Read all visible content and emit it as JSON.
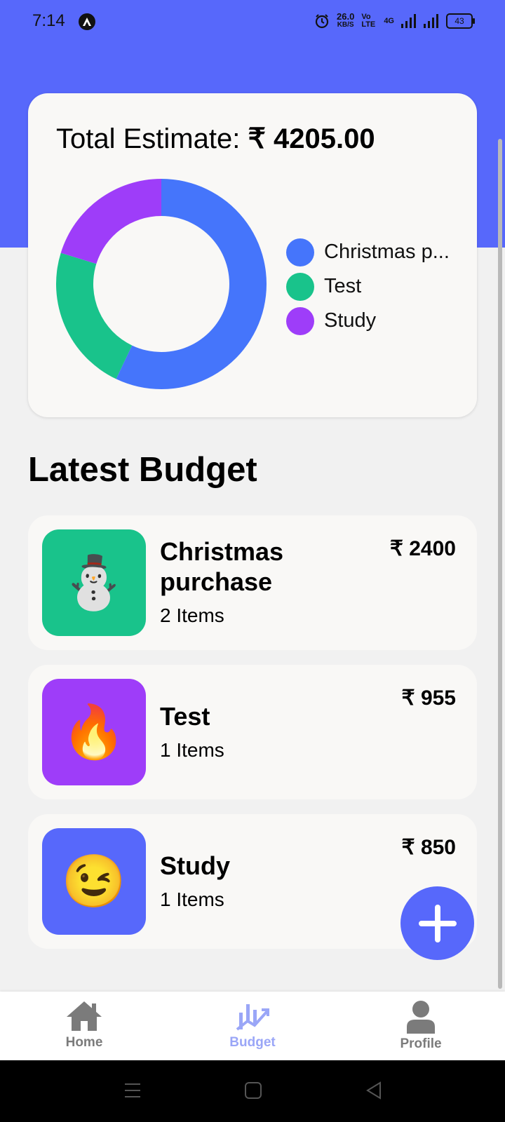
{
  "status_bar": {
    "time": "7:14",
    "net_speed": "26.0",
    "net_unit": "KB/S",
    "volte": "Vo LTE",
    "network": "4G",
    "battery": "43"
  },
  "estimate": {
    "label": "Total Estimate:",
    "amount": "₹ 4205.00"
  },
  "chart_data": {
    "type": "pie",
    "categories": [
      "Christmas purchase",
      "Test",
      "Study"
    ],
    "values": [
      2400,
      955,
      850
    ],
    "colors": [
      "#4575fb",
      "#19c38b",
      "#9e3df9"
    ],
    "legend_labels": [
      "Christmas p...",
      "Test",
      "Study"
    ],
    "legend_position": "right"
  },
  "section_title": "Latest Budget",
  "budgets": [
    {
      "name_line1": "Christmas",
      "name_line2": "purchase",
      "count": "2 Items",
      "amount": "₹ 2400",
      "icon": "⛄",
      "icon_name": "snowman-icon",
      "color": "#19c38b"
    },
    {
      "name": "Test",
      "count": "1 Items",
      "amount": "₹ 955",
      "icon": "🔥",
      "icon_name": "fire-icon",
      "color": "#9e3df9"
    },
    {
      "name": "Study",
      "count": "1 Items",
      "amount": "₹ 850",
      "icon": "😉",
      "icon_name": "wink-icon",
      "color": "#5768fb"
    }
  ],
  "nav": {
    "home": "Home",
    "budget": "Budget",
    "profile": "Profile",
    "active_color": "#9aa6f7",
    "inactive_color": "#7b7b7b"
  },
  "accent": "#5768fb"
}
